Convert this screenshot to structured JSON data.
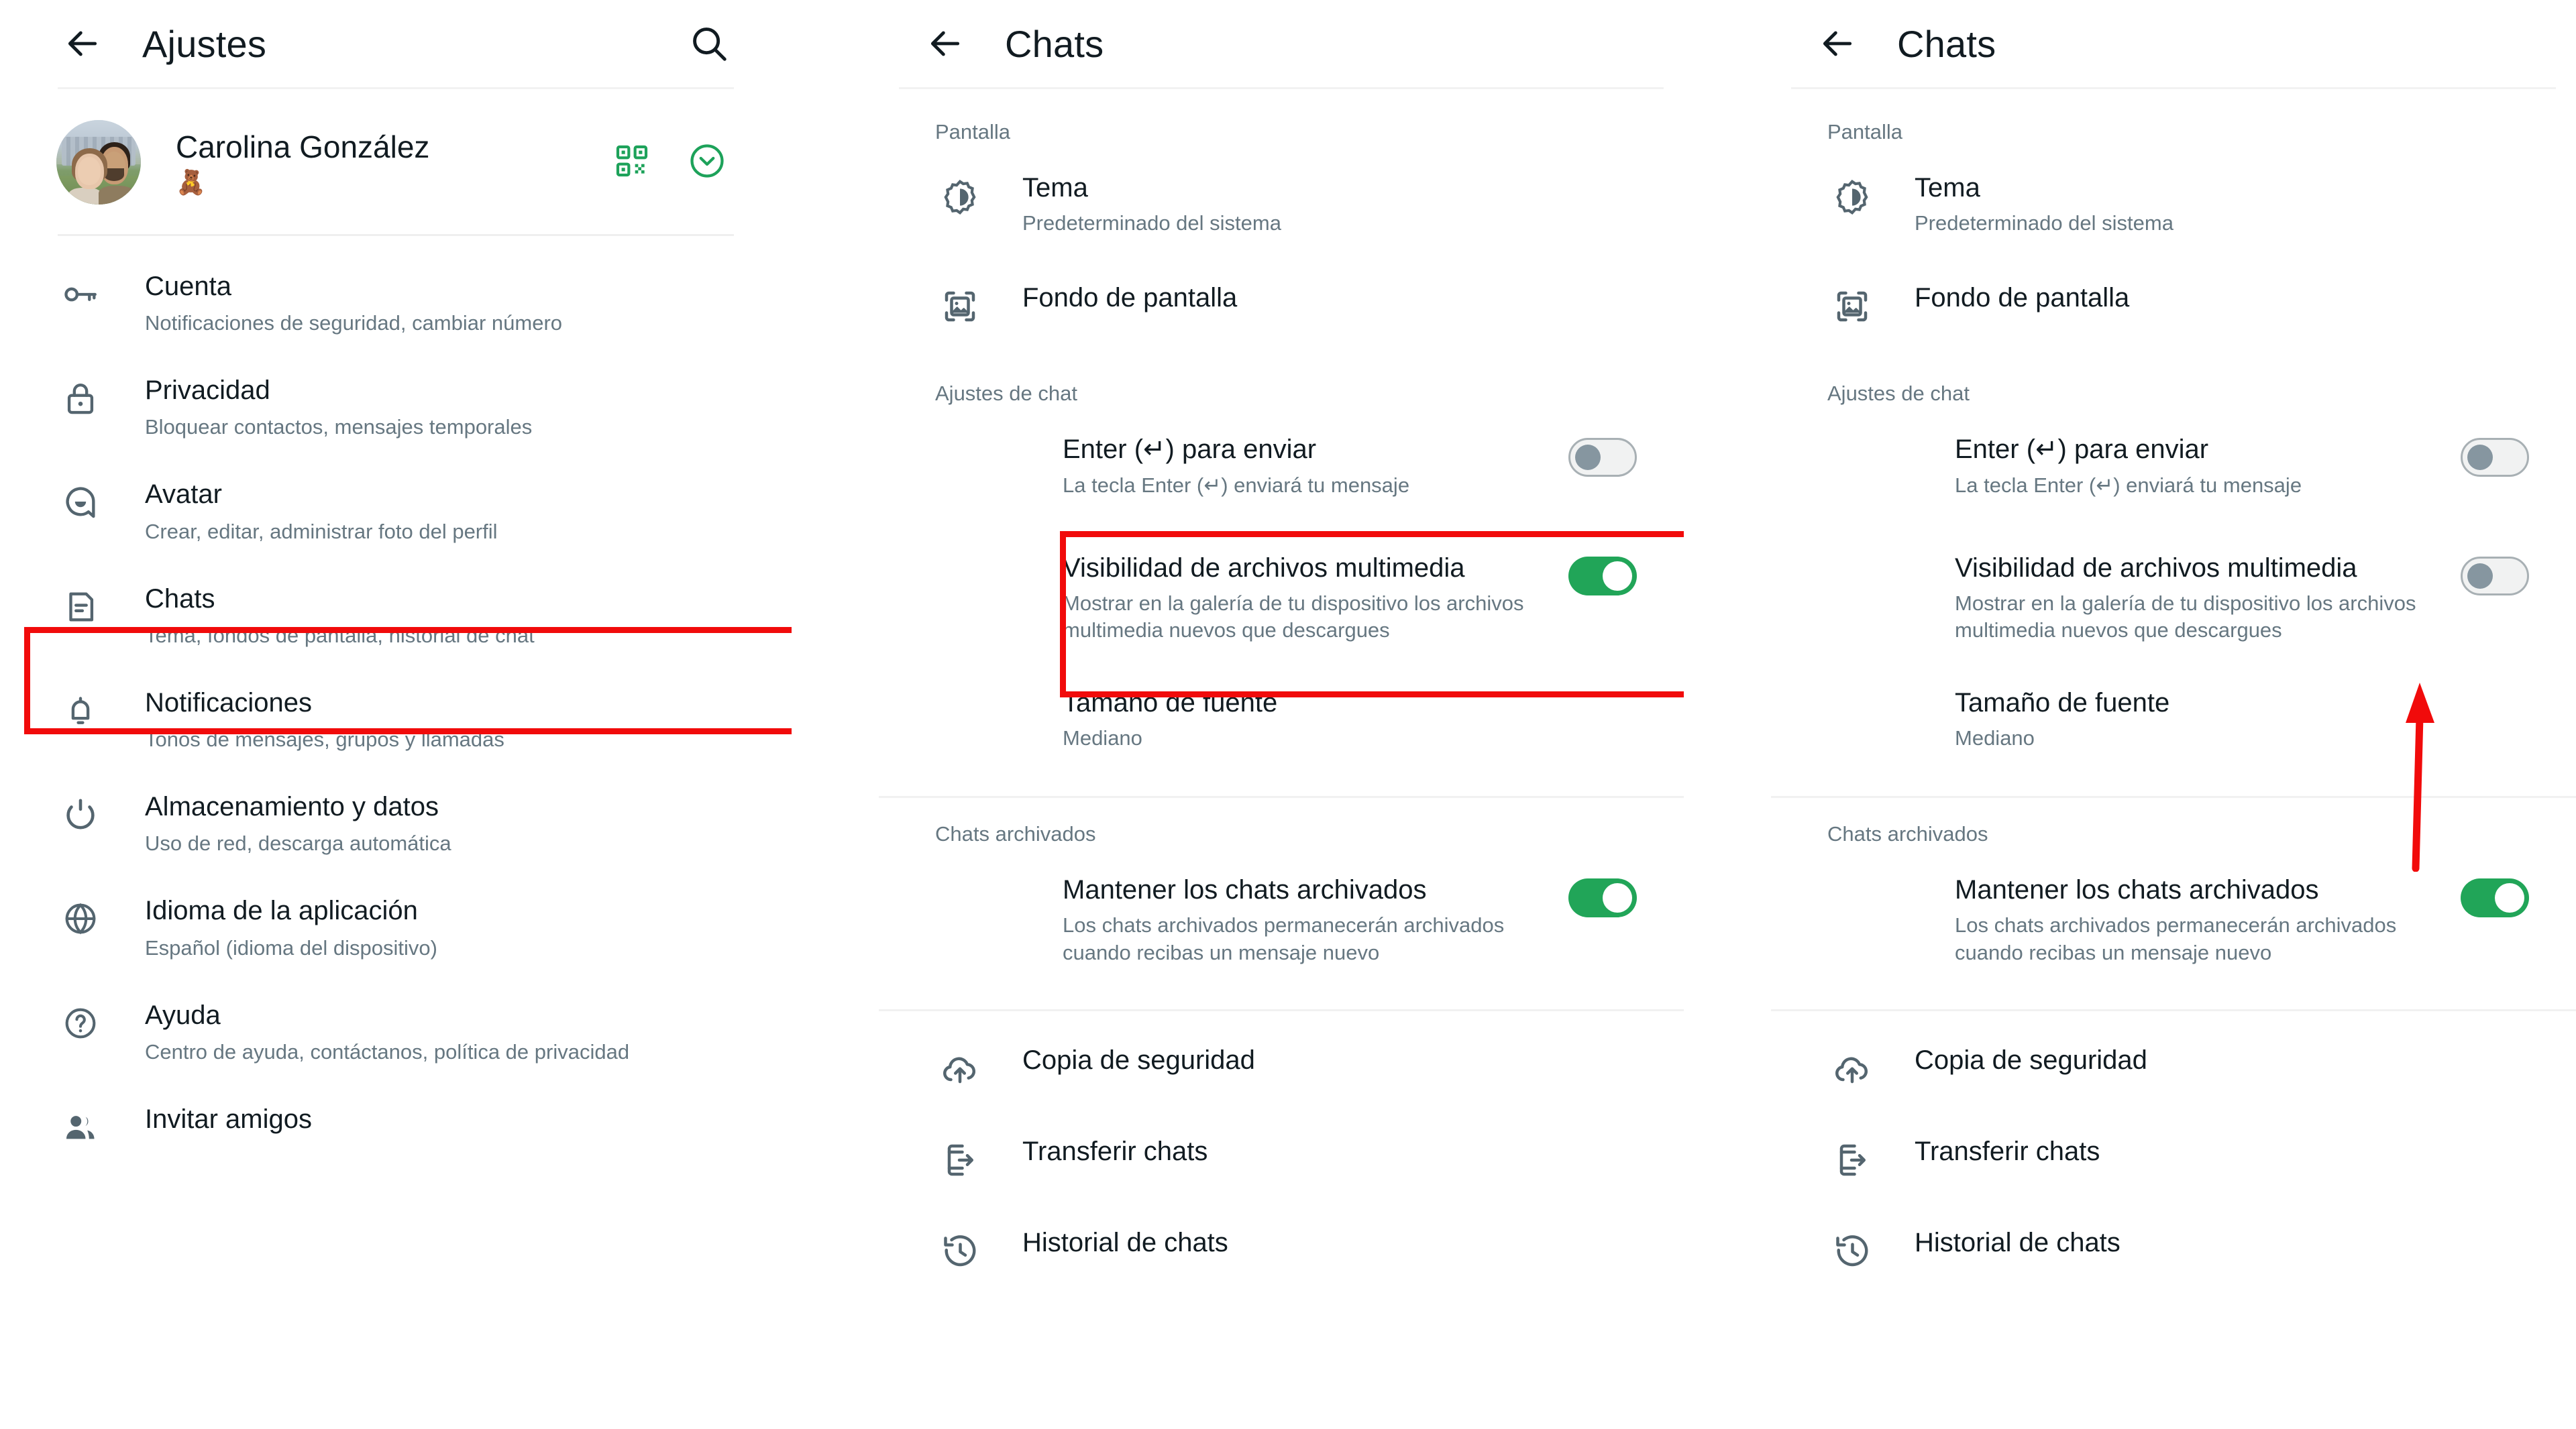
{
  "meta": {
    "accent_green": "#21a558",
    "highlight_red": "#f10b0b",
    "text_primary": "#111b21",
    "text_secondary": "#667781"
  },
  "panel1": {
    "appbar": {
      "title": "Ajustes",
      "back_icon": "arrow-left-icon",
      "search_icon": "search-icon"
    },
    "profile": {
      "name": "Carolina González",
      "status_emoji": "🧸",
      "qr_icon": "qr-code-icon",
      "status_icon": "chevron-down-circle-icon"
    },
    "items": [
      {
        "icon": "key-icon",
        "title": "Cuenta",
        "subtitle": "Notificaciones de seguridad, cambiar número"
      },
      {
        "icon": "lock-icon",
        "title": "Privacidad",
        "subtitle": "Bloquear contactos, mensajes temporales"
      },
      {
        "icon": "avatar-icon",
        "title": "Avatar",
        "subtitle": "Crear, editar, administrar foto del perfil"
      },
      {
        "icon": "chat-icon",
        "title": "Chats",
        "subtitle": "Tema, fondos de pantalla, historial de chat"
      },
      {
        "icon": "bell-icon",
        "title": "Notificaciones",
        "subtitle": "Tonos de mensajes, grupos y llamadas"
      },
      {
        "icon": "storage-icon",
        "title": "Almacenamiento y datos",
        "subtitle": "Uso de red, descarga automática"
      },
      {
        "icon": "globe-icon",
        "title": "Idioma de la aplicación",
        "subtitle": "Español (idioma del dispositivo)"
      },
      {
        "icon": "help-icon",
        "title": "Ayuda",
        "subtitle": "Centro de ayuda, contáctanos, política de privacidad"
      },
      {
        "icon": "invite-icon",
        "title": "Invitar amigos",
        "subtitle": ""
      }
    ]
  },
  "panel2": {
    "appbar": {
      "title": "Chats",
      "back_icon": "arrow-left-icon"
    },
    "section_display": "Pantalla",
    "display_items": [
      {
        "icon": "theme-icon",
        "title": "Tema",
        "subtitle": "Predeterminado del sistema"
      },
      {
        "icon": "wallpaper-icon",
        "title": "Fondo de pantalla",
        "subtitle": ""
      }
    ],
    "section_chat": "Ajustes de chat",
    "chat_items": [
      {
        "title": "Enter (↵) para enviar",
        "subtitle": "La tecla Enter (↵) enviará tu mensaje",
        "toggle": "off"
      },
      {
        "title": "Visibilidad de archivos multimedia",
        "subtitle": "Mostrar en la galería de tu dispositivo los archivos multimedia nuevos que descargues",
        "toggle": "on"
      },
      {
        "title": "Tamaño de fuente",
        "subtitle": "Mediano",
        "toggle": "none"
      }
    ],
    "section_archived": "Chats archivados",
    "archived_items": [
      {
        "title": "Mantener los chats archivados",
        "subtitle": "Los chats archivados permanecerán archivados cuando recibas un mensaje nuevo",
        "toggle": "on"
      }
    ],
    "bottom_items": [
      {
        "icon": "backup-icon",
        "title": "Copia de seguridad"
      },
      {
        "icon": "transfer-icon",
        "title": "Transferir chats"
      },
      {
        "icon": "history-icon",
        "title": "Historial de chats"
      }
    ]
  },
  "panel3": {
    "appbar": {
      "title": "Chats",
      "back_icon": "arrow-left-icon"
    },
    "section_display": "Pantalla",
    "display_items": [
      {
        "icon": "theme-icon",
        "title": "Tema",
        "subtitle": "Predeterminado del sistema"
      },
      {
        "icon": "wallpaper-icon",
        "title": "Fondo de pantalla",
        "subtitle": ""
      }
    ],
    "section_chat": "Ajustes de chat",
    "chat_items": [
      {
        "title": "Enter (↵) para enviar",
        "subtitle": "La tecla Enter (↵) enviará tu mensaje",
        "toggle": "off"
      },
      {
        "title": "Visibilidad de archivos multimedia",
        "subtitle": "Mostrar en la galería de tu dispositivo los archivos multimedia nuevos que descargues",
        "toggle": "off"
      },
      {
        "title": "Tamaño de fuente",
        "subtitle": "Mediano",
        "toggle": "none"
      }
    ],
    "section_archived": "Chats archivados",
    "archived_items": [
      {
        "title": "Mantener los chats archivados",
        "subtitle": "Los chats archivados permanecerán archivados cuando recibas un mensaje nuevo",
        "toggle": "on"
      }
    ],
    "bottom_items": [
      {
        "icon": "backup-icon",
        "title": "Copia de seguridad"
      },
      {
        "icon": "transfer-icon",
        "title": "Transferir chats"
      },
      {
        "icon": "history-icon",
        "title": "Historial de chats"
      }
    ]
  },
  "annotations": {
    "box_chats_item": "Chats",
    "box_media_visibility": "Visibilidad de archivos multimedia",
    "arrow_points_to": "Visibilidad de archivos multimedia toggle"
  }
}
